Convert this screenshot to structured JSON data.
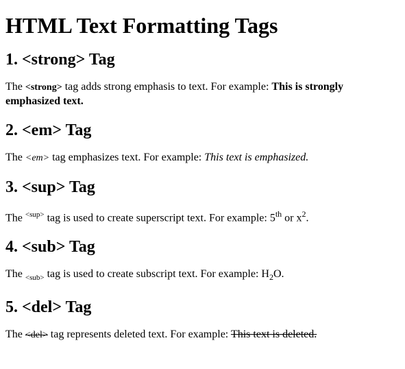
{
  "title": "HTML Text Formatting Tags",
  "sections": [
    {
      "heading": "1. <strong> Tag",
      "pre": "The ",
      "tag": "<strong>",
      "mid": " tag adds strong emphasis to text. For example: ",
      "example": "This is strongly emphasized text."
    },
    {
      "heading": "2. <em> Tag",
      "pre": "The ",
      "tag": "<em>",
      "mid": " tag emphasizes text. For example: ",
      "example": "This text is emphasized."
    },
    {
      "heading": "3. <sup> Tag",
      "pre": "The ",
      "tag": "<sup>",
      "mid": " tag is used to create superscript text. For example: ",
      "ex1_base": "5",
      "ex1_sup": "th",
      "ex_join": " or ",
      "ex2_base": "x",
      "ex2_sup": "2",
      "end": "."
    },
    {
      "heading": "4. <sub> Tag",
      "pre": "The ",
      "tag": "<sub>",
      "mid": " tag is used to create subscript text. For example: ",
      "ex_a": "H",
      "ex_sub": "2",
      "ex_b": "O",
      "end": "."
    },
    {
      "heading": "5. <del> Tag",
      "pre": "The ",
      "tag": "<del>",
      "mid": " tag represents deleted text. For example: ",
      "example": "This text is deleted."
    }
  ]
}
